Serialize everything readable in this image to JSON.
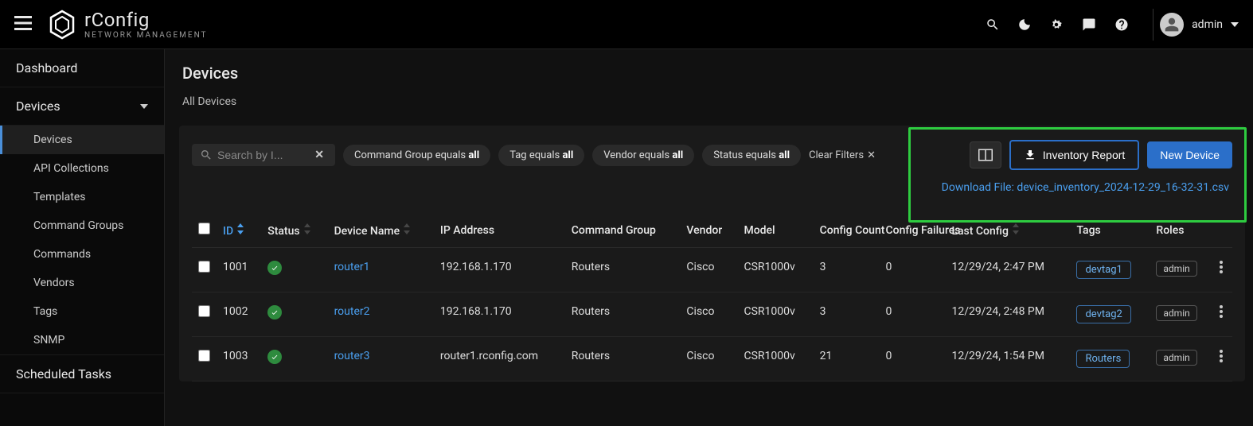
{
  "brand": {
    "name": "rConfig",
    "tagline": "NETWORK MANAGEMENT"
  },
  "user": {
    "name": "admin"
  },
  "sidebar": {
    "dashboard": "Dashboard",
    "devices_section": "Devices",
    "items": [
      {
        "label": "Devices"
      },
      {
        "label": "API Collections"
      },
      {
        "label": "Templates"
      },
      {
        "label": "Command Groups"
      },
      {
        "label": "Commands"
      },
      {
        "label": "Vendors"
      },
      {
        "label": "Tags"
      },
      {
        "label": "SNMP"
      }
    ],
    "scheduled": "Scheduled Tasks"
  },
  "header": {
    "title": "Devices",
    "subtitle": "All Devices"
  },
  "toolbar": {
    "search_placeholder": "Search by I...",
    "filters": {
      "command_group_prefix": "Command Group equals ",
      "command_group_value": "all",
      "tag_prefix": "Tag equals ",
      "tag_value": "all",
      "vendor_prefix": "Vendor equals ",
      "vendor_value": "all",
      "status_prefix": "Status equals ",
      "status_value": "all"
    },
    "clear_filters": "Clear Filters",
    "inventory_report": "Inventory Report",
    "new_device": "New Device"
  },
  "download": {
    "prefix": "Download File: ",
    "filename": "device_inventory_2024-12-29_16-32-31.csv"
  },
  "columns": {
    "id": "ID",
    "status": "Status",
    "device_name": "Device Name",
    "ip": "IP Address",
    "command_group": "Command Group",
    "vendor": "Vendor",
    "model": "Model",
    "config_count": "Config Count",
    "config_failures": "Config Failures",
    "last_config": "Last Config",
    "tags": "Tags",
    "roles": "Roles"
  },
  "rows": [
    {
      "id": "1001",
      "name": "router1",
      "ip": "192.168.1.170",
      "group": "Routers",
      "vendor": "Cisco",
      "model": "CSR1000v",
      "count": "3",
      "failures": "0",
      "last": "12/29/24, 2:47 PM",
      "tag": "devtag1",
      "role": "admin"
    },
    {
      "id": "1002",
      "name": "router2",
      "ip": "192.168.1.170",
      "group": "Routers",
      "vendor": "Cisco",
      "model": "CSR1000v",
      "count": "3",
      "failures": "0",
      "last": "12/29/24, 2:48 PM",
      "tag": "devtag2",
      "role": "admin"
    },
    {
      "id": "1003",
      "name": "router3",
      "ip": "router1.rconfig.com",
      "group": "Routers",
      "vendor": "Cisco",
      "model": "CSR1000v",
      "count": "21",
      "failures": "0",
      "last": "12/29/24, 1:54 PM",
      "tag": "Routers",
      "role": "admin"
    }
  ]
}
